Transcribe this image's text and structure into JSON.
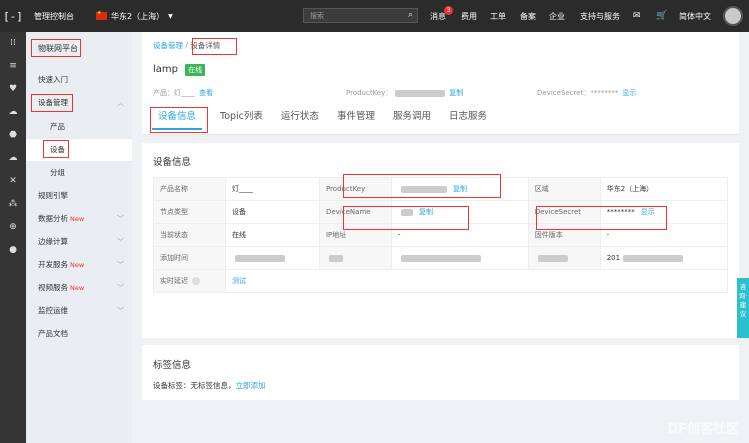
{
  "topbar": {
    "logo": "[-]",
    "console": "管理控制台",
    "region": "华东2（上海）",
    "search_placeholder": "搜索",
    "nav": {
      "message": "消息",
      "message_count": "3",
      "cost": "费用",
      "ticket": "工单",
      "record": "备案",
      "enterprise": "企业",
      "support": "支持与服务",
      "language": "简体中文"
    }
  },
  "rail": [
    "⁞⁞",
    "≡",
    "♥",
    "☁",
    "⬣",
    "☁",
    "✕",
    "⁂",
    "⊕",
    "●"
  ],
  "sidebar": {
    "platform": "物联网平台",
    "items": [
      {
        "label": "快速入门"
      },
      {
        "label": "设备管理"
      },
      {
        "label": "产品"
      },
      {
        "label": "设备"
      },
      {
        "label": "分组"
      },
      {
        "label": "规则引擎"
      },
      {
        "label": "数据分析",
        "badge": "New"
      },
      {
        "label": "边缘计算"
      },
      {
        "label": "开发服务",
        "badge": "New"
      },
      {
        "label": "视频服务",
        "badge": "New"
      },
      {
        "label": "监控运维"
      },
      {
        "label": "产品文档"
      }
    ]
  },
  "breadcrumb": {
    "parent": "设备管理",
    "current": "设备详情"
  },
  "device": {
    "name": "lamp",
    "status": "在线",
    "product_label": "产品：灯____",
    "view": "查看",
    "productkey_label": "ProductKey：",
    "copy": "复制",
    "secret_label": "DeviceSecret：********",
    "show": "显示"
  },
  "tabs": [
    "设备信息",
    "Topic列表",
    "运行状态",
    "事件管理",
    "服务调用",
    "日志服务"
  ],
  "info": {
    "title": "设备信息",
    "rows": [
      [
        [
          "产品名称",
          "灯____",
          ""
        ],
        [
          "ProductKey",
          "",
          "复制"
        ],
        [
          "区域",
          "华东2（上海）",
          ""
        ]
      ],
      [
        [
          "节点类型",
          "设备",
          ""
        ],
        [
          "DeviceName",
          "",
          "复制"
        ],
        [
          "DeviceSecret",
          "********",
          "显示"
        ]
      ],
      [
        [
          "当前状态",
          "在线",
          ""
        ],
        [
          "IP地址",
          "-",
          ""
        ],
        [
          "固件版本",
          "-",
          ""
        ]
      ],
      [
        [
          "添加时间",
          "",
          ""
        ],
        [
          "",
          "",
          ""
        ],
        [
          "",
          "201",
          ""
        ]
      ],
      [
        [
          "实时延迟",
          "",
          "测试"
        ]
      ]
    ]
  },
  "tags": {
    "title": "标签信息",
    "label": "设备标签：无标签信息，",
    "add": "立即添加"
  },
  "help": "咨询·建议",
  "watermark": "DF创客社区"
}
